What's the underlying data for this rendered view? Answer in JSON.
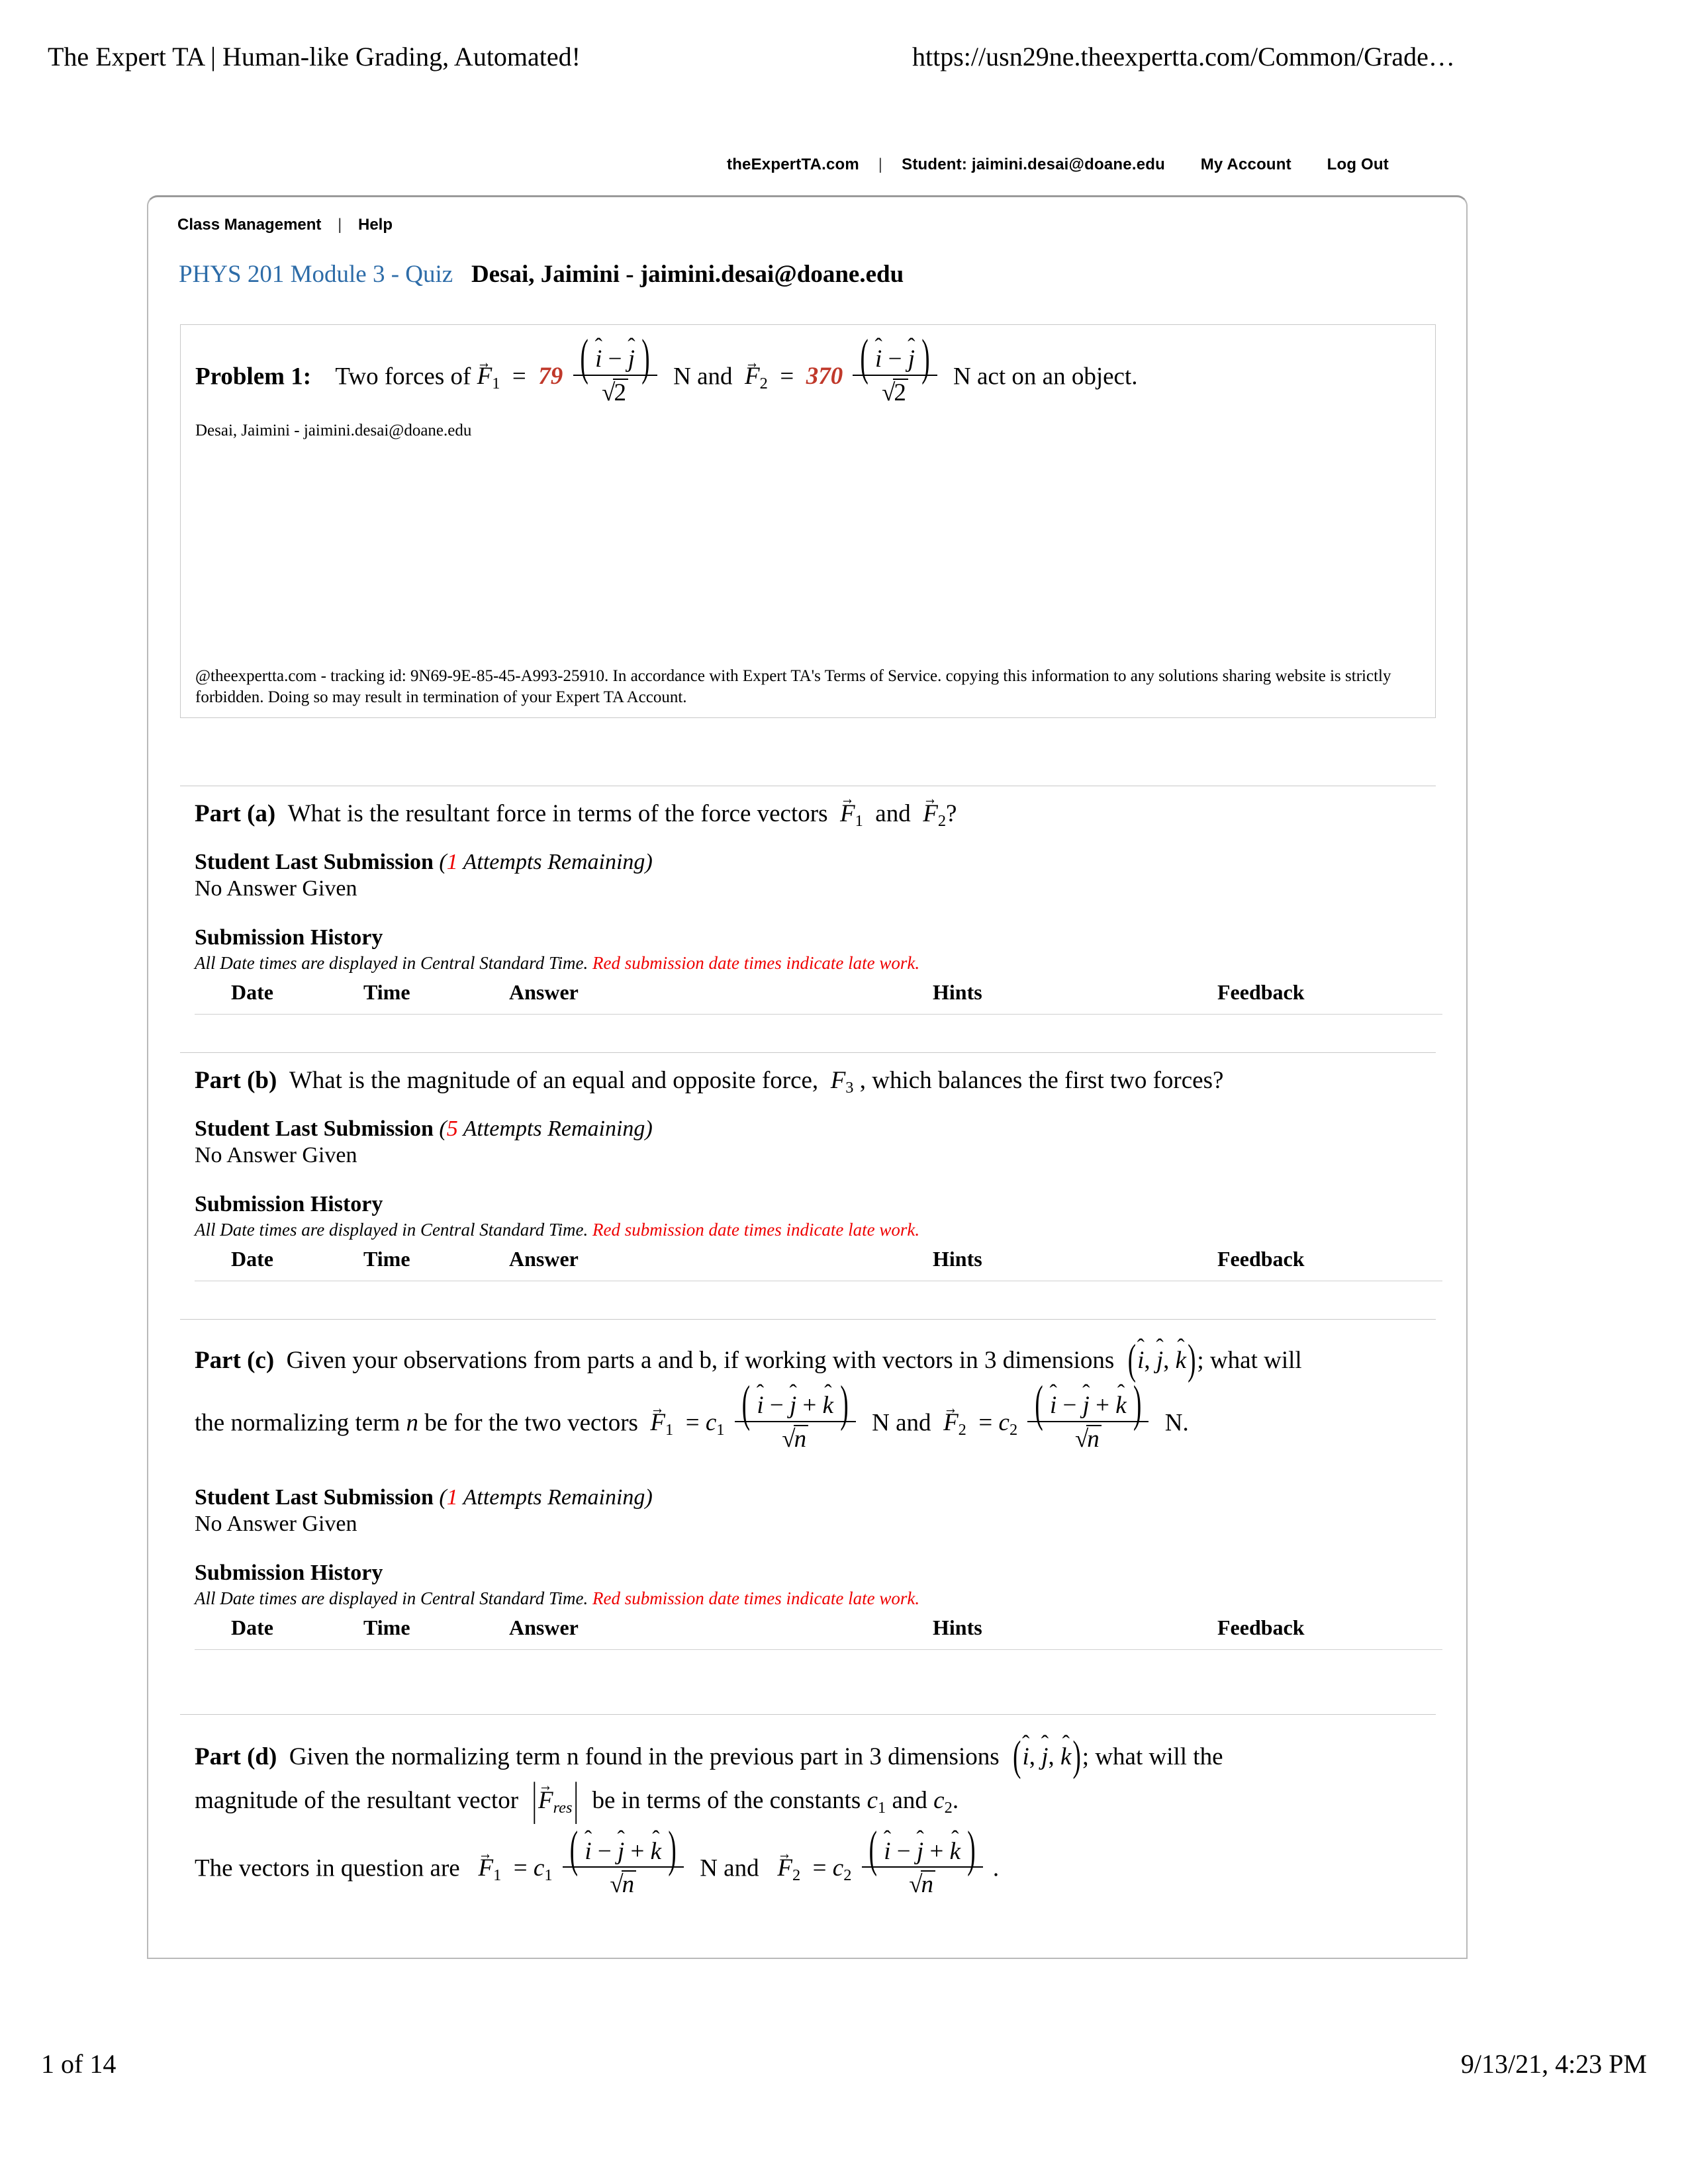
{
  "print": {
    "header_title": "The Expert TA | Human-like Grading, Automated!",
    "header_url": "https://usn29ne.theexpertta.com/Common/Grade…",
    "footer_page": "1 of 14",
    "footer_date": "9/13/21, 4:23 PM"
  },
  "topbar": {
    "site": "theExpertTA.com",
    "separator": "|",
    "student": "Student: jaimini.desai@doane.edu",
    "my_account": "My Account",
    "log_out": "Log Out"
  },
  "panel_nav": {
    "class_management": "Class Management",
    "separator": "|",
    "help": "Help"
  },
  "assignment": {
    "course_title": "PHYS 201 Module 3 - Quiz",
    "student_name": "Desai, Jaimini - jaimini.desai@doane.edu"
  },
  "problem": {
    "label": "Problem 1:",
    "text_1": "Two forces of",
    "f1_coefficient": "79",
    "f2_coefficient": "370",
    "text_mid": "N and",
    "text_end": "N act on an object.",
    "numerator": "( î − ĵ )",
    "denominator": "√2",
    "student_stamp": "Desai, Jaimini - jaimini.desai@doane.edu",
    "tracking_notice": "@theexpertta.com - tracking id: 9N69-9E-85-45-A993-25910. In accordance with Expert TA's Terms of Service. copying this information to any solutions sharing website is strictly forbidden. Doing so may result in termination of your Expert TA Account.",
    "tracking_id": "9N69-9E-85-45-A993-25910"
  },
  "common": {
    "student_last_submission": "Student Last Submission",
    "attempts_suffix": "Attempts Remaining",
    "no_answer_given": "No Answer Given",
    "submission_history": "Submission History",
    "tz_note": "All Date times are displayed in Central Standard Time.",
    "tz_note_late": "Red submission date times indicate late work.",
    "columns": [
      "Date",
      "Time",
      "Answer",
      "Hints",
      "Feedback"
    ],
    "accent_red": "#ee0000",
    "value_red": "#c0392b",
    "link_blue": "#2d6ca8"
  },
  "parts": [
    {
      "label": "Part (a)",
      "question": "What is the resultant force in terms of the force vectors F⃗1 and F⃗2?",
      "attempts_remaining": "1",
      "answer": "No Answer Given"
    },
    {
      "label": "Part (b)",
      "question": "What is the magnitude of an equal and opposite force, F3, which balances the first two forces?",
      "attempts_remaining": "5",
      "answer": "No Answer Given"
    },
    {
      "label": "Part (c)",
      "question": "Given your observations from parts a and b, if working with vectors in 3 dimensions (î, ĵ, k̂); what will the normalizing term n be for the two vectors F⃗1 = c1 (î − ĵ + k̂)/√n N and F⃗2 = c2 (î − ĵ + k̂)/√n N.",
      "line1_prefix": "Given your observations from parts a and b, if working with vectors in 3 dimensions",
      "line1_suffix": "; what will",
      "line2_prefix": "the normalizing term n be for the two vectors",
      "attempts_remaining": "1",
      "answer": "No Answer Given"
    },
    {
      "label": "Part (d)",
      "question": "Given the normalizing term n found in the previous part in 3 dimensions (î, ĵ, k̂); what will the magnitude of the resultant vector |F⃗res| be in terms of the constants c1 and c2.",
      "line1_prefix": "Given the normalizing term n found in the previous part in 3 dimensions",
      "line1_suffix": "; what will the",
      "line2_prefix": "magnitude of the resultant vector",
      "line2_suffix": "be in terms of the constants c1 and c2.",
      "line3_prefix": "The vectors in question are",
      "line3_mid": "N and",
      "line3_end": "."
    }
  ]
}
